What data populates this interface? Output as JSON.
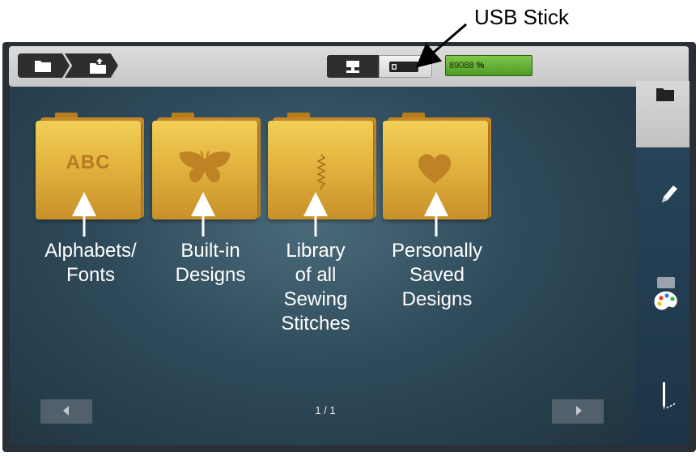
{
  "annotation_top": "USB Stick",
  "storage": {
    "capacity_value": "89088",
    "capacity_unit": "%"
  },
  "folders": [
    {
      "label": "Alphabets/\nFonts",
      "icon": "abc-text",
      "icon_text": "ABC"
    },
    {
      "label": "Built-in\nDesigns",
      "icon": "butterfly-icon"
    },
    {
      "label": "Library\nof all\nSewing\nStitches",
      "icon": "stitch-icon"
    },
    {
      "label": "Personally\nSaved\nDesigns",
      "icon": "heart-icon"
    }
  ],
  "pager": {
    "page": "1 / 1"
  },
  "sidebar": [
    "folder-icon",
    "pencil-icon",
    "palette-icon",
    "needle-icon"
  ],
  "colors": {
    "folder": "#e2b43e",
    "capacity_bar": "#6abb3a",
    "background": "#2f4b5b"
  }
}
